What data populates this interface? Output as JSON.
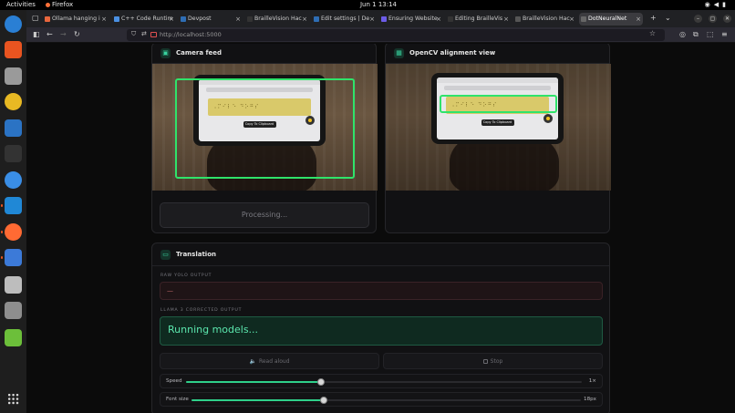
{
  "topbar": {
    "activities": "Activities",
    "app": "Firefox",
    "clock": "Jun 1  13:14"
  },
  "dock": {
    "items": [
      {
        "name": "thunderbird-icon",
        "color": "#2a7fd4"
      },
      {
        "name": "app-center-icon",
        "color": "#e95420"
      },
      {
        "name": "files-icon",
        "color": "#9a9a9a"
      },
      {
        "name": "rhythmbox-icon",
        "color": "#e8b923"
      },
      {
        "name": "libreoffice-writer-icon",
        "color": "#2b73c4"
      },
      {
        "name": "terminal-icon",
        "color": "#333333"
      },
      {
        "name": "help-icon",
        "color": "#3a8ee6"
      },
      {
        "name": "vscode-icon",
        "color": "#2088d6"
      },
      {
        "name": "firefox-icon",
        "color": "#ff6a33"
      },
      {
        "name": "text-editor-icon",
        "color": "#3c7ad8"
      },
      {
        "name": "disc-icon",
        "color": "#bdbdbd"
      },
      {
        "name": "drive-icon",
        "color": "#8e8e8e"
      },
      {
        "name": "trash-icon",
        "color": "#6cbf3a"
      }
    ]
  },
  "browser": {
    "tabs": [
      {
        "label": "Ollama hanging i",
        "color": "#e8663d"
      },
      {
        "label": "C++ Code Runtim",
        "color": "#4a90e2"
      },
      {
        "label": "Devpost",
        "color": "#2e6db4"
      },
      {
        "label": "BrailleVision Hac",
        "color": "#333333"
      },
      {
        "label": "Edit settings | De",
        "color": "#2e6db4"
      },
      {
        "label": "Ensuring Website",
        "color": "#6c5ce7"
      },
      {
        "label": "Editing BrailleVis",
        "color": "#333333"
      },
      {
        "label": "BrailleVision Hac",
        "color": "#555555"
      },
      {
        "label": "DotNeuralNet",
        "color": "#666666"
      }
    ],
    "url": "http://localhost:5000"
  },
  "camera_panel": {
    "title": "Camera feed",
    "braille_text": "⠠⠍⠊⠇⠑ ⠙⠕⠛⠎",
    "copy_label": "Copy To Clipboard",
    "button_label": "Processing..."
  },
  "opencv_panel": {
    "title": "OpenCV alignment view"
  },
  "translation": {
    "title": "Translation",
    "raw_label": "RAW YOLO OUTPUT",
    "raw_value": "—",
    "corrected_label": "LLAMA 3 CORRECTED OUTPUT",
    "corrected_value": "Running models...",
    "read_aloud": "Read aloud",
    "stop": "Stop",
    "speed": {
      "label": "Speed",
      "value": "1×",
      "fraction": 0.34
    },
    "font_size": {
      "label": "Font size",
      "value": "18px",
      "fraction": 0.34
    }
  },
  "colors": {
    "accent": "#2fd08a",
    "detection": "#2fe36a"
  }
}
